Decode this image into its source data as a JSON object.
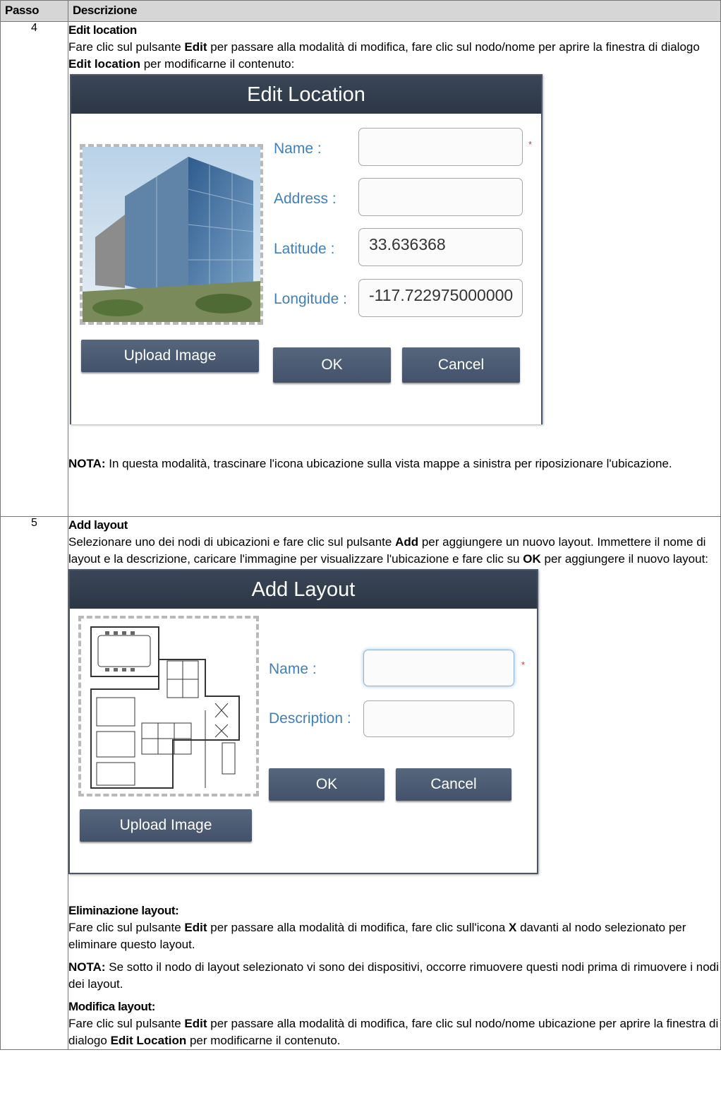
{
  "table": {
    "headers": {
      "step": "Passo",
      "description": "Descrizione"
    },
    "rows": [
      {
        "step": "4",
        "title": "Edit location",
        "intro": {
          "t1": "Fare clic sul pulsante ",
          "b1": "Edit",
          "t2": " per passare alla modalità di modifica, fare clic sul nodo/nome per aprire la finestra di dialogo ",
          "b2": "Edit location",
          "t3": " per modificarne il contenuto:"
        },
        "dialog": {
          "title": "Edit Location",
          "fields": [
            {
              "label": "Name :",
              "value": "",
              "required": "*"
            },
            {
              "label": "Address :",
              "value": ""
            },
            {
              "label": "Latitude :",
              "value": "33.636368"
            },
            {
              "label": "Longitude :",
              "value": "-117.722975000000"
            }
          ],
          "upload_label": "Upload Image",
          "ok_label": "OK",
          "cancel_label": "Cancel"
        },
        "note": {
          "label": "NOTA:",
          "text": " In questa modalità, trascinare l'icona ubicazione sulla vista mappe a sinistra per riposizionare l'ubicazione."
        }
      },
      {
        "step": "5",
        "title": "Add layout",
        "intro": {
          "t1": "Selezionare uno dei nodi di ubicazioni e fare clic sul pulsante ",
          "b1": "Add",
          "t2": " per aggiungere un nuovo layout. Immettere il nome di layout e la descrizione, caricare l'immagine per visualizzare l'ubicazione e fare clic su ",
          "b2": "OK",
          "t3": " per aggiungere il nuovo layout:"
        },
        "dialog": {
          "title": "Add Layout",
          "fields": [
            {
              "label": "Name :",
              "value": "",
              "required": "*"
            },
            {
              "label": "Description :",
              "value": ""
            }
          ],
          "upload_label": "Upload Image",
          "ok_label": "OK",
          "cancel_label": "Cancel"
        },
        "delete": {
          "title": "Eliminazione layout:",
          "t1": "Fare clic sul pulsante ",
          "b1": "Edit",
          "t2": " per passare alla modalità di modifica, fare clic sull'icona ",
          "b2": "X",
          "t3": " davanti al nodo selezionato per eliminare questo layout."
        },
        "note": {
          "label": "NOTA:",
          "text": " Se sotto il nodo di layout selezionato vi sono dei dispositivi, occorre rimuovere questi nodi prima di rimuovere i nodi dei layout."
        },
        "edit": {
          "title": "Modifica layout:",
          "t1": "Fare clic sul pulsante ",
          "b1": "Edit",
          "t2": " per passare alla modalità di modifica, fare clic sul nodo/nome ubicazione per aprire la finestra di dialogo ",
          "b2": "Edit Location",
          "t3": " per modificarne il contenuto."
        }
      }
    ]
  }
}
